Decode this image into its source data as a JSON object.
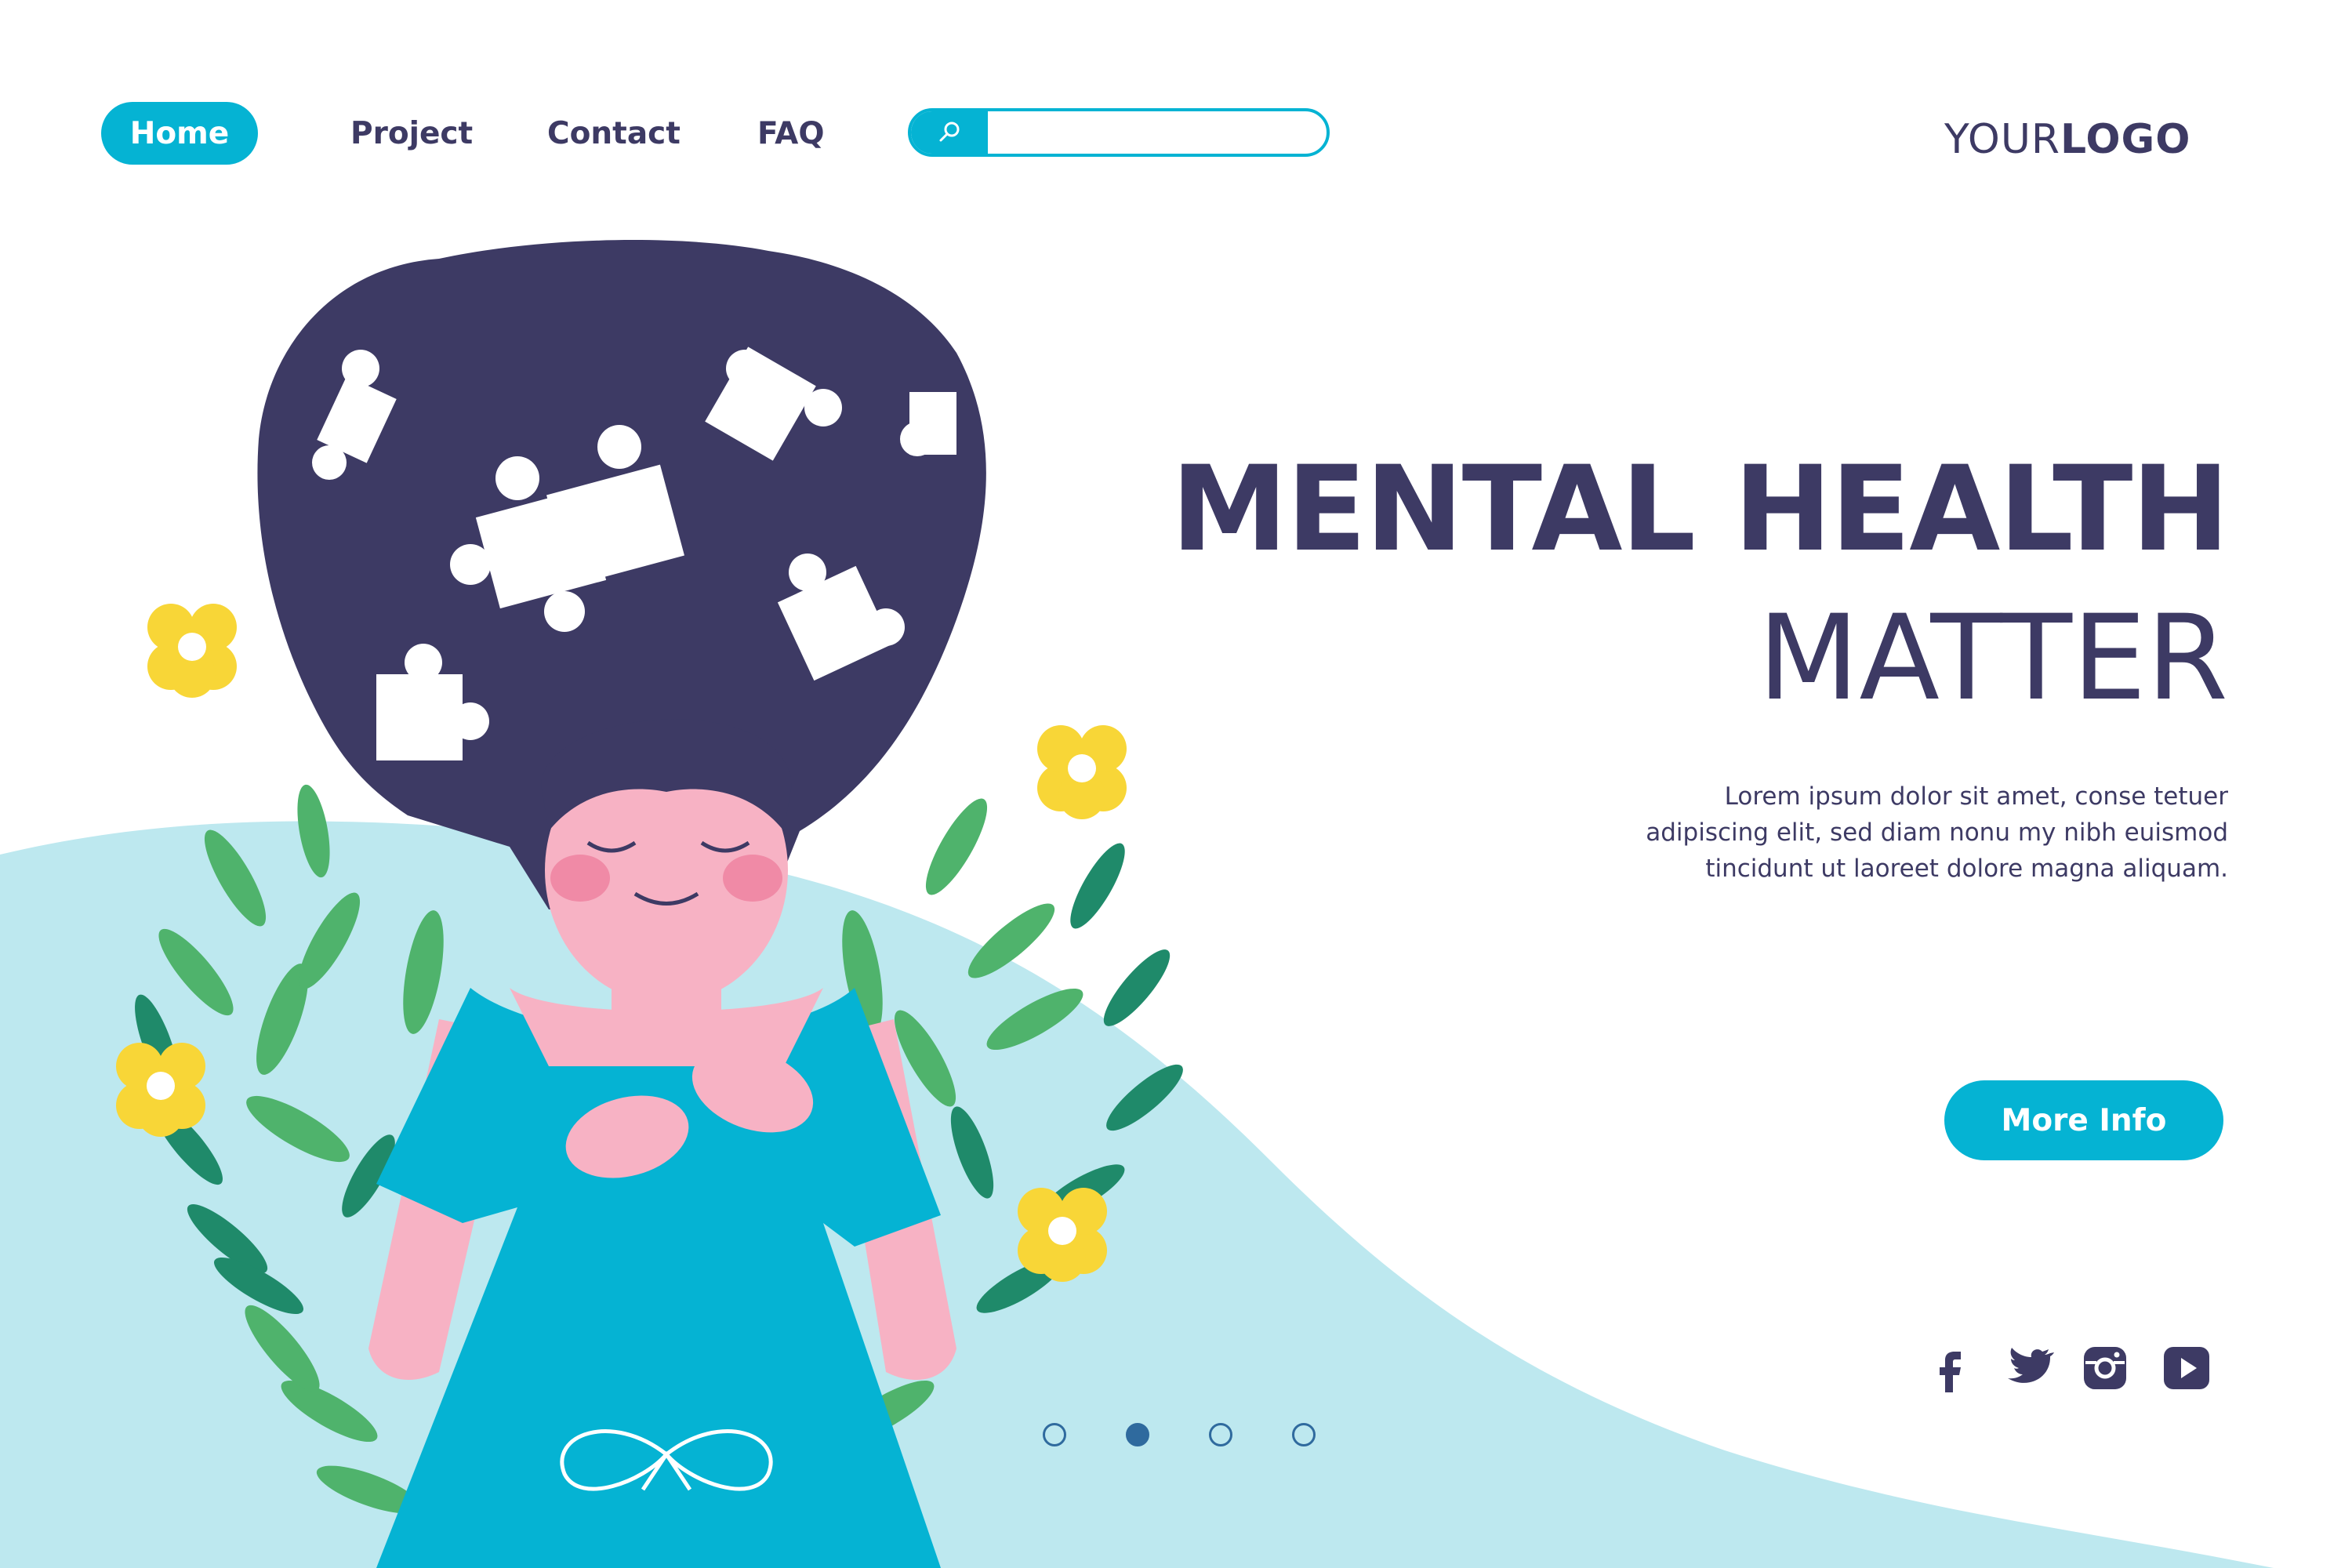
{
  "nav": {
    "items": [
      {
        "label": "Home",
        "active": true
      },
      {
        "label": "Project",
        "active": false
      },
      {
        "label": "Contact",
        "active": false
      },
      {
        "label": "FAQ",
        "active": false
      }
    ],
    "search": {
      "icon": "search-icon",
      "value": "",
      "placeholder": ""
    }
  },
  "logo": {
    "light": "YOUR",
    "bold": "LOGO"
  },
  "hero": {
    "title_line1": "MENTAL HEALTH",
    "title_line2": "MATTER",
    "body": "Lorem ipsum dolor sit amet, conse tetuer adipiscing elit, sed diam nonu my nibh euismod tincidunt ut laoreet dolore magna aliquam.",
    "cta_label": "More Info"
  },
  "social": [
    "facebook-icon",
    "twitter-icon",
    "instagram-icon",
    "youtube-icon"
  ],
  "pagination": {
    "count": 4,
    "active_index": 1
  },
  "colors": {
    "accent": "#05b3d3",
    "text": "#3d3a64",
    "wave": "#bde8ef",
    "leaf_light": "#4fb36c",
    "leaf_dark": "#1f8a6a",
    "flower": "#f8d637",
    "skin": "#f7b2c4",
    "hair": "#3d3a64"
  }
}
